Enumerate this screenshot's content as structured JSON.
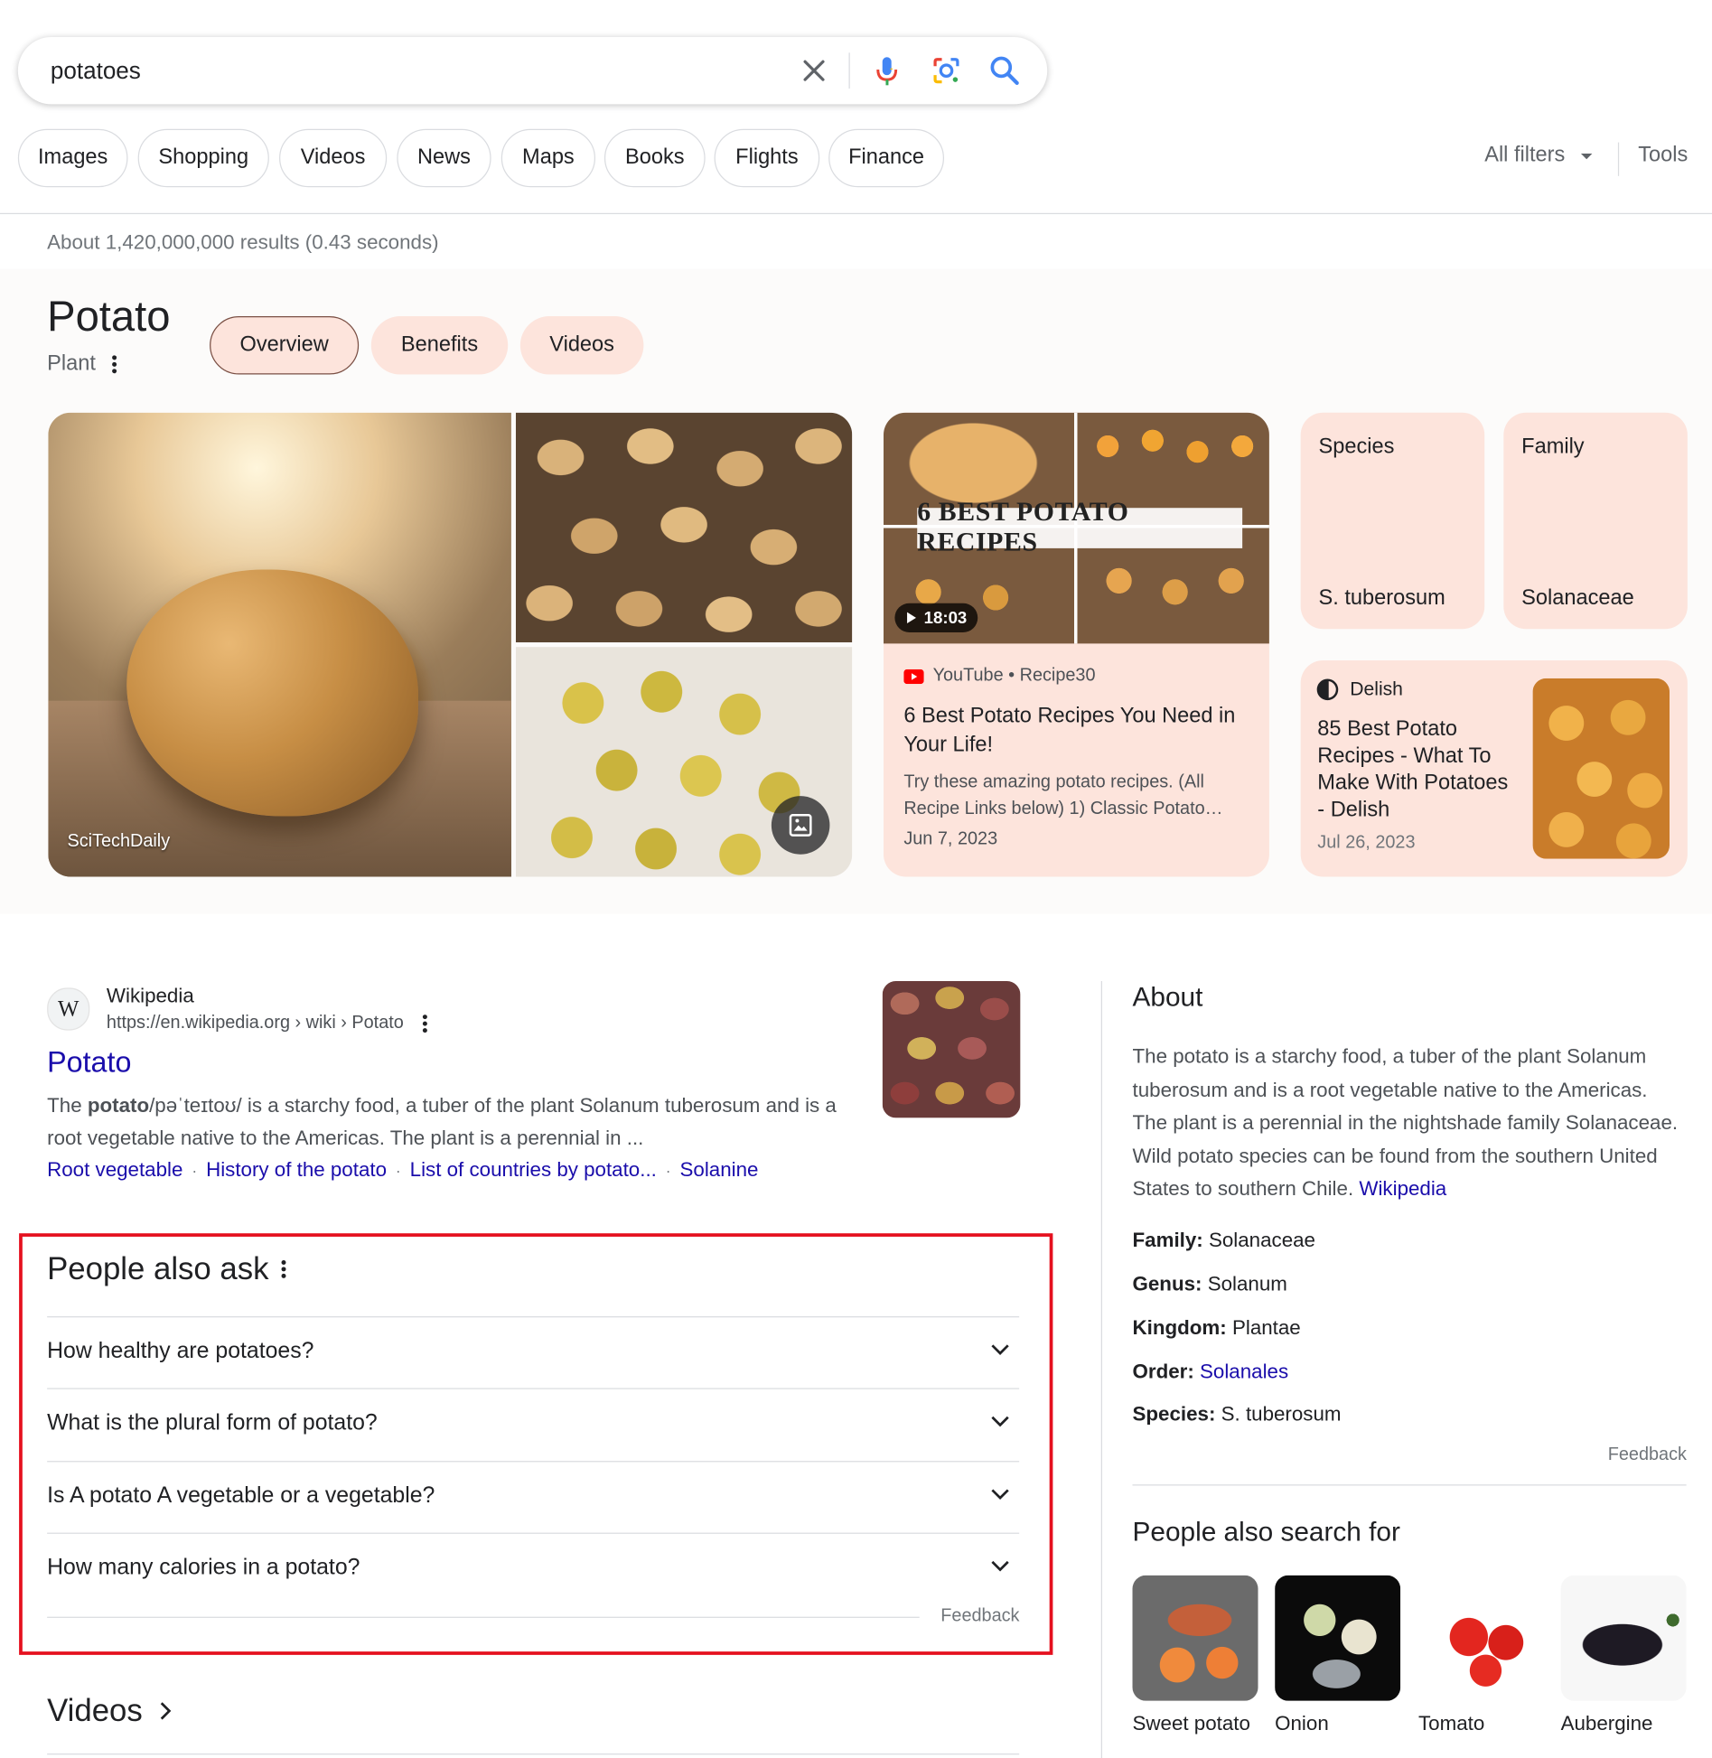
{
  "search": {
    "query": "potatoes"
  },
  "filters": [
    "Images",
    "Shopping",
    "Videos",
    "News",
    "Maps",
    "Books",
    "Flights",
    "Finance"
  ],
  "all_filters_label": "All filters",
  "tools_label": "Tools",
  "result_stats": "About 1,420,000,000 results (0.43 seconds)",
  "knowledge_panel": {
    "title": "Potato",
    "subtitle": "Plant",
    "tabs": [
      "Overview",
      "Benefits",
      "Videos"
    ],
    "image_credit": "SciTechDaily",
    "video": {
      "banner": "6 BEST POTATO RECIPES",
      "duration": "18:03",
      "source": "YouTube • Recipe30",
      "title": "6 Best Potato Recipes You Need in Your Life!",
      "snippet": "Try these amazing potato recipes. (All Recipe Links below) 1) Classic Potato…",
      "date": "Jun 7, 2023"
    },
    "facts": [
      {
        "label": "Species",
        "value": "S. tuberosum"
      },
      {
        "label": "Family",
        "value": "Solanaceae"
      }
    ],
    "article": {
      "source": "Delish",
      "title": "85 Best Potato Recipes - What To Make With Potatoes - Delish",
      "date": "Jul 26, 2023"
    }
  },
  "wikipedia_result": {
    "site_name": "Wikipedia",
    "url": "https://en.wikipedia.org › wiki › Potato",
    "title": "Potato",
    "snippet_term": "potato",
    "snippet_prefix": "The ",
    "snippet_rest": "/pəˈteɪtoʊ/ is a starchy food, a tuber of the plant Solanum tuberosum and is a root vegetable native to the Americas. The plant is a perennial in ...",
    "sitelinks": [
      "Root vegetable",
      "History of the potato",
      "List of countries by potato...",
      "Solanine"
    ]
  },
  "people_also_ask": {
    "title": "People also ask",
    "questions": [
      "How healthy are potatoes?",
      "What is the plural form of potato?",
      "Is A potato A vegetable or a vegetable?",
      "How many calories in a potato?"
    ],
    "feedback": "Feedback"
  },
  "videos_heading": "Videos",
  "about": {
    "heading": "About",
    "text": "The potato is a starchy food, a tuber of the plant Solanum tuberosum and is a root vegetable native to the Americas. The plant is a perennial in the nightshade family Solanaceae. Wild potato species can be found from the southern United States to southern Chile.",
    "source_link": "Wikipedia",
    "facts": [
      {
        "label": "Family:",
        "value": "Solanaceae",
        "link": false
      },
      {
        "label": "Genus:",
        "value": "Solanum",
        "link": false
      },
      {
        "label": "Kingdom:",
        "value": "Plantae",
        "link": false
      },
      {
        "label": "Order:",
        "value": "Solanales",
        "link": true
      },
      {
        "label": "Species:",
        "value": "S. tuberosum",
        "link": false
      }
    ],
    "feedback": "Feedback"
  },
  "people_also_search_for": {
    "heading": "People also search for",
    "items": [
      "Sweet potato",
      "Onion",
      "Tomato",
      "Aubergine"
    ]
  },
  "colors": {
    "link": "#1a0dab",
    "chip_tint": "#fde4dc",
    "highlight_border": "#e5101e"
  }
}
